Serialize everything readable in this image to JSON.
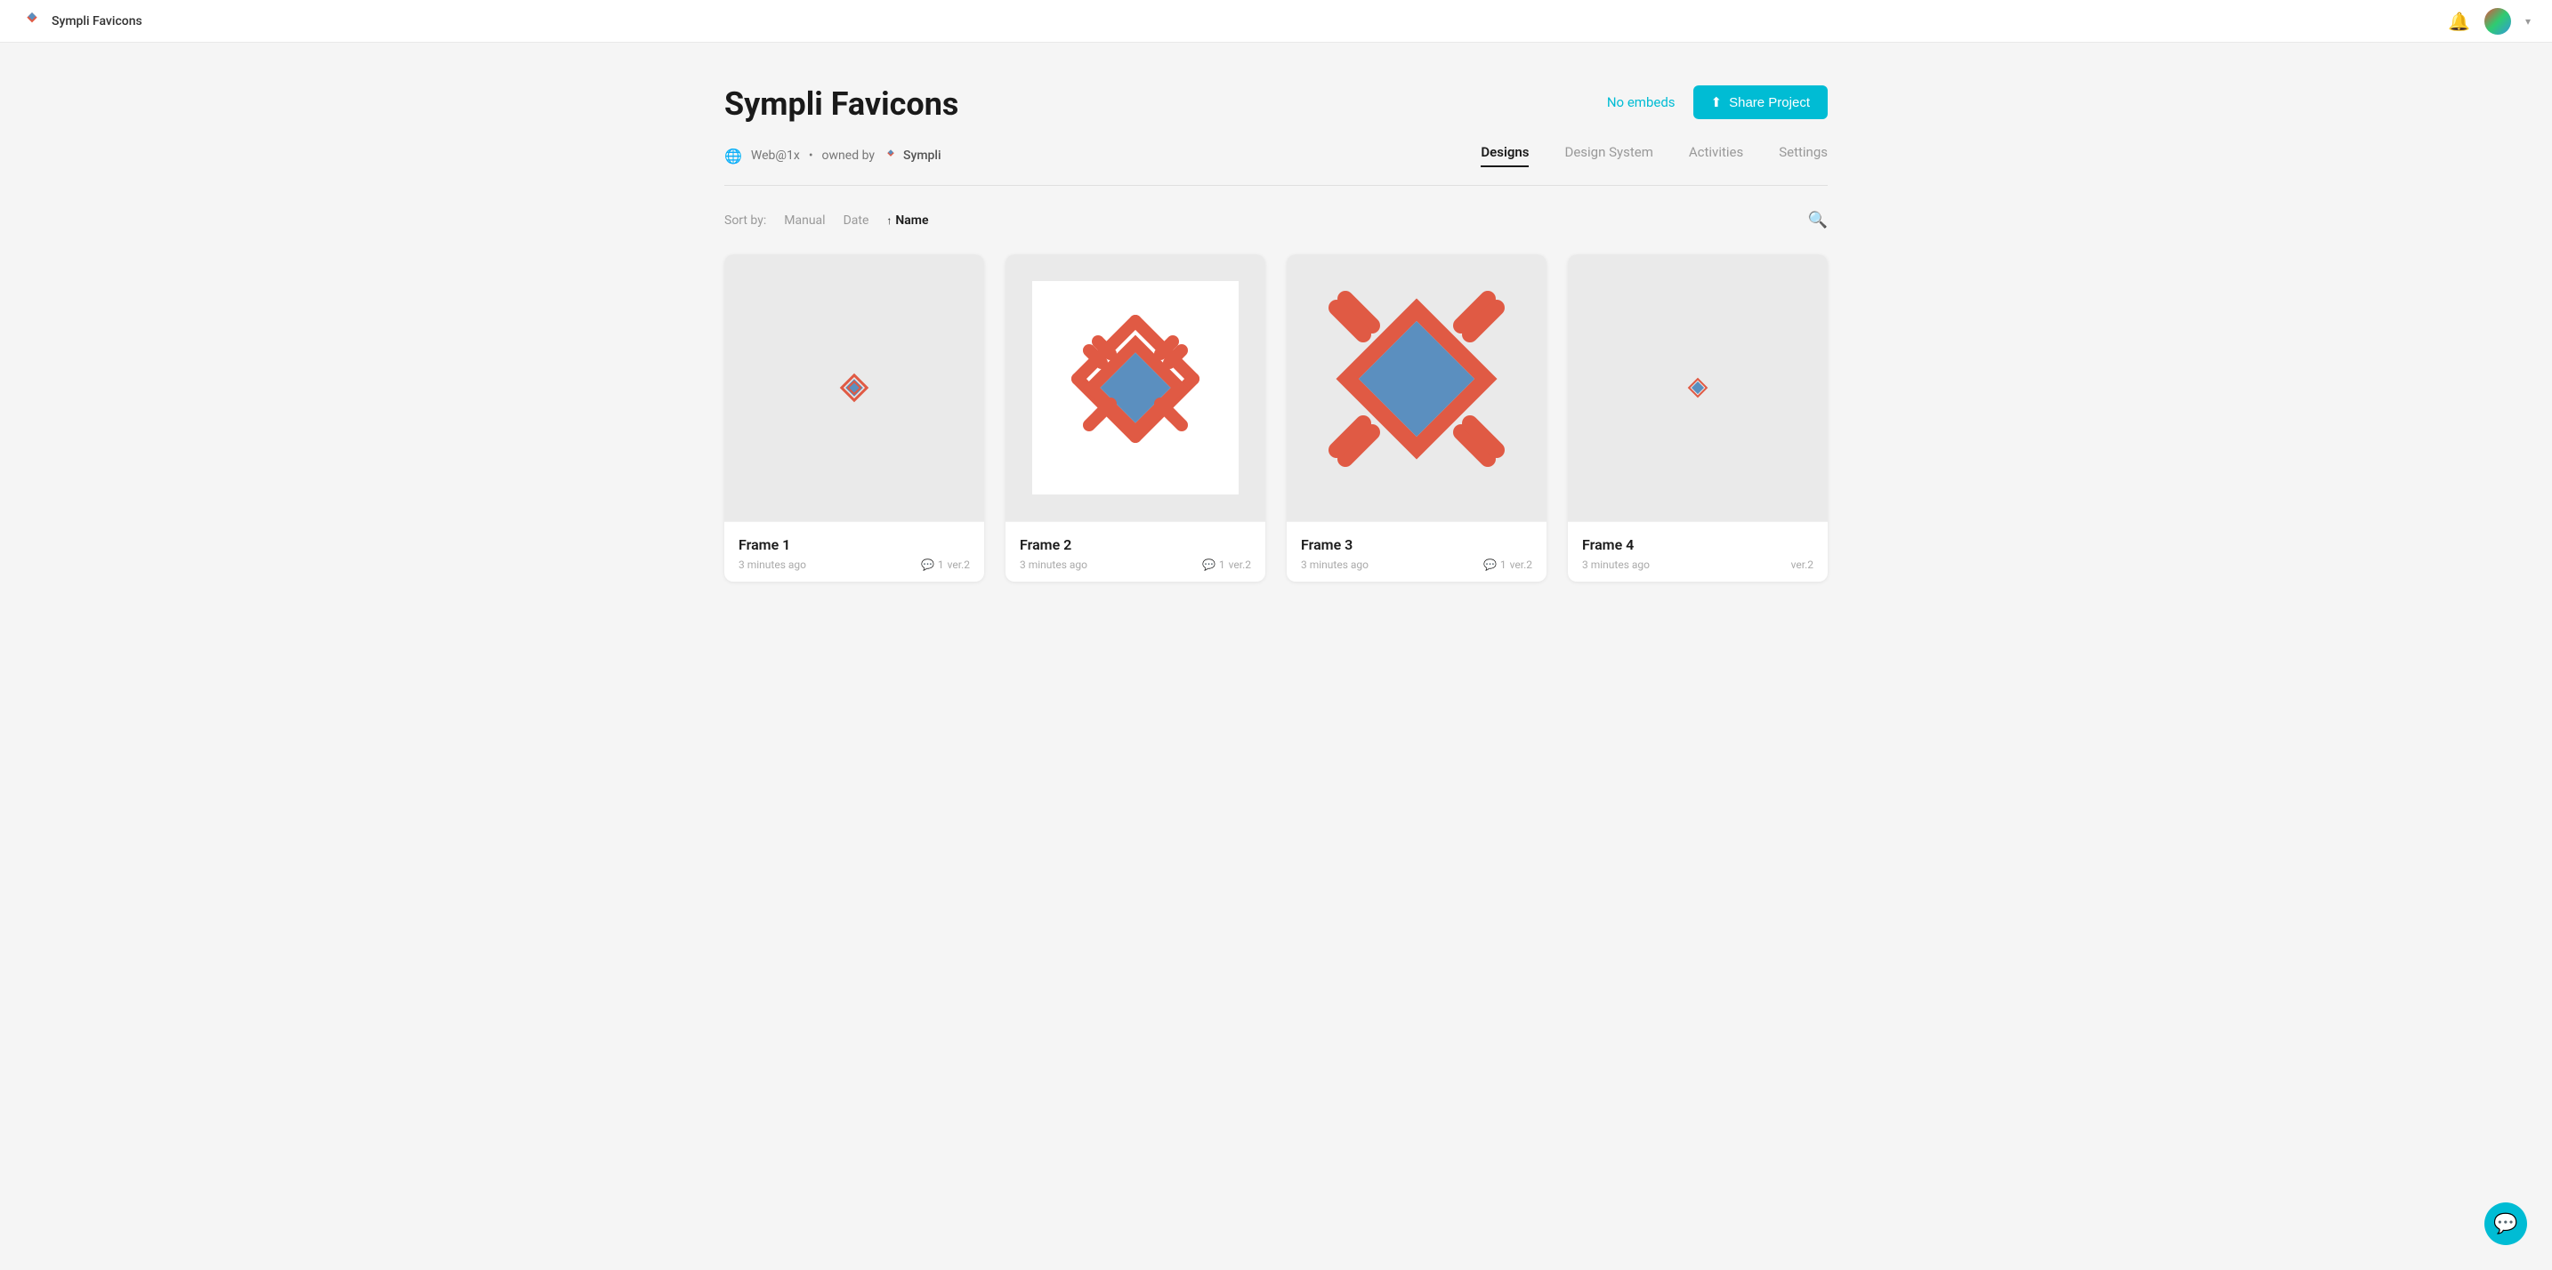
{
  "topnav": {
    "title": "Sympli Favicons",
    "bell_label": "notifications",
    "chevron_label": "user menu"
  },
  "header": {
    "title": "Sympli Favicons",
    "no_embeds_label": "No embeds",
    "share_btn_label": "Share Project"
  },
  "subtitle": {
    "scope": "Web@1x",
    "separator": "•",
    "owned_by_text": "owned by",
    "owner_name": "Sympli"
  },
  "tabs": [
    {
      "id": "designs",
      "label": "Designs",
      "active": true
    },
    {
      "id": "design-system",
      "label": "Design System",
      "active": false
    },
    {
      "id": "activities",
      "label": "Activities",
      "active": false
    },
    {
      "id": "settings",
      "label": "Settings",
      "active": false
    }
  ],
  "sort": {
    "label": "Sort by:",
    "options": [
      {
        "id": "manual",
        "label": "Manual",
        "active": false
      },
      {
        "id": "date",
        "label": "Date",
        "active": false
      },
      {
        "id": "name",
        "label": "Name",
        "active": true,
        "arrow": "↑"
      }
    ]
  },
  "cards": [
    {
      "id": "frame1",
      "name": "Frame 1",
      "time": "3 minutes ago",
      "comments": "1",
      "version": "ver.2",
      "size": "small"
    },
    {
      "id": "frame2",
      "name": "Frame 2",
      "time": "3 minutes ago",
      "comments": "1",
      "version": "ver.2",
      "size": "medium"
    },
    {
      "id": "frame3",
      "name": "Frame 3",
      "time": "3 minutes ago",
      "comments": "1",
      "version": "ver.2",
      "size": "large"
    },
    {
      "id": "frame4",
      "name": "Frame 4",
      "time": "3 minutes ago",
      "comments": "",
      "version": "ver.2",
      "size": "small"
    }
  ],
  "colors": {
    "accent": "#00bcd4",
    "logo_red": "#e05a44",
    "logo_blue": "#5b8fbf",
    "card_bg": "#f0f0f0"
  }
}
